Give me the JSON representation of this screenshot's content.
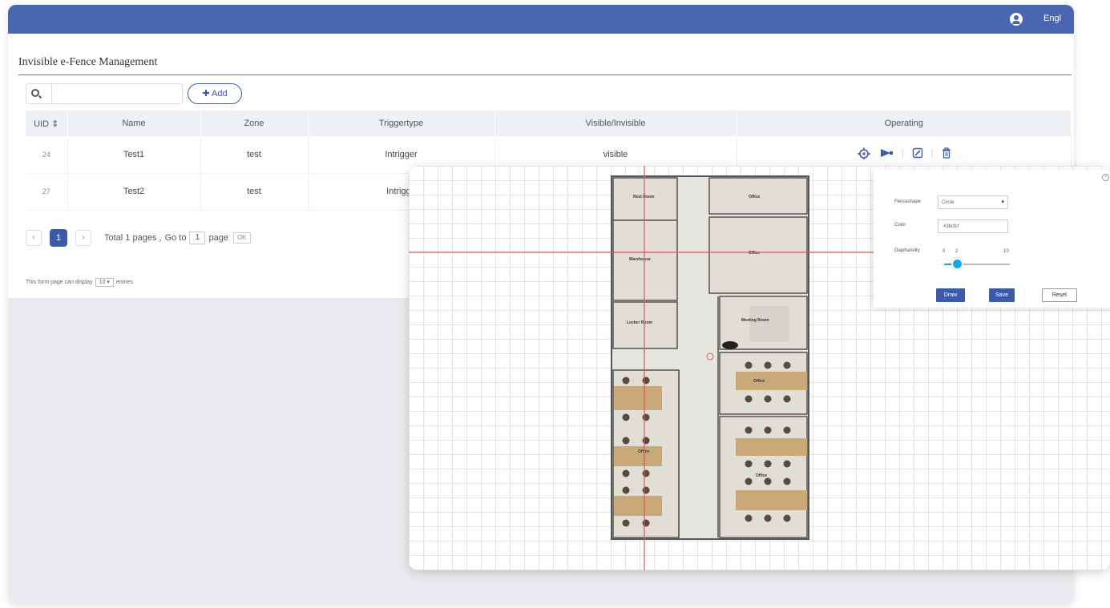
{
  "header": {
    "language": "Engl"
  },
  "page": {
    "title": "Invisible e-Fence Management"
  },
  "search": {
    "value": "",
    "placeholder": ""
  },
  "toolbar": {
    "add_label": "✚ Add"
  },
  "table": {
    "columns": [
      "UID ⇕",
      "Name",
      "Zone",
      "Triggertype",
      "Visible/Invisible",
      "Operating"
    ],
    "rows": [
      {
        "uid": "24",
        "name": "Test1",
        "zone": "test",
        "triggertype": "Intrigger",
        "visibility": "visible"
      },
      {
        "uid": "27",
        "name": "Test2",
        "zone": "test",
        "triggertype": "Intrigge",
        "visibility": ""
      }
    ],
    "operation_icons": [
      "locate-fence-icon",
      "camera-icon",
      "edit-icon",
      "delete-icon"
    ]
  },
  "pagination": {
    "prev": "‹",
    "current": "1",
    "next": "›",
    "total_text": "Total 1 pages ,",
    "goto_text": "Go to",
    "goto_value": "1",
    "page_text": "page",
    "ok_label": "OK"
  },
  "display": {
    "prefix": "This form page can display",
    "value": "10 ▾",
    "suffix": "entries"
  },
  "floorplan": {
    "rooms": [
      "Rest Room",
      "Office",
      "Warehouse",
      "Office",
      "Locker Room",
      "Meeting Room",
      "Office",
      "Office",
      "Office"
    ]
  },
  "fence_form": {
    "close": "×",
    "shape_label": "Fenceshape",
    "shape_value": "Circle",
    "color_label": "Color",
    "color_value": "#3bcfcf",
    "opacity_label": "Diaphaneity",
    "opacity_min": "0",
    "opacity_value": "2",
    "opacity_max": "10",
    "opacity_level": 0.2,
    "draw_label": "Draw",
    "save_label": "Save",
    "reset_label": "Reset"
  },
  "colors": {
    "header": "#4a66b0",
    "accent": "#3b5ba9",
    "slider": "#1aa3e8",
    "crosshair": "#e05555"
  }
}
